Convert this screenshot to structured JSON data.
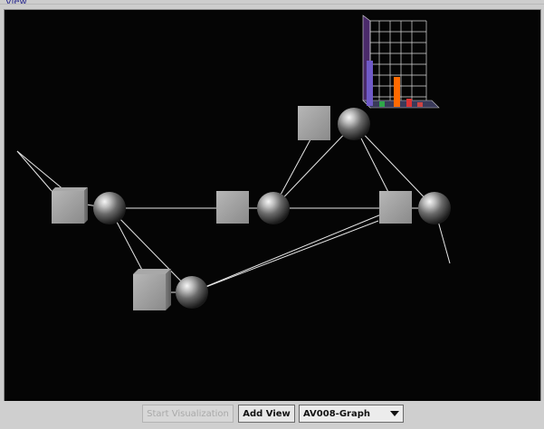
{
  "panel": {
    "title": "View"
  },
  "toolbar": {
    "start_label": "Start Visualization",
    "add_view_label": "Add View",
    "view_select_value": "AV008-Graph",
    "start_enabled": false
  },
  "scene": {
    "background": "#050505",
    "line_color": "#e6e6e6",
    "node_color": "#9b9b9b",
    "chart_bar_colors": [
      "#6f5ac8",
      "#2fa64a",
      "#ff6a00",
      "#d33",
      "#c44",
      "#333"
    ]
  }
}
